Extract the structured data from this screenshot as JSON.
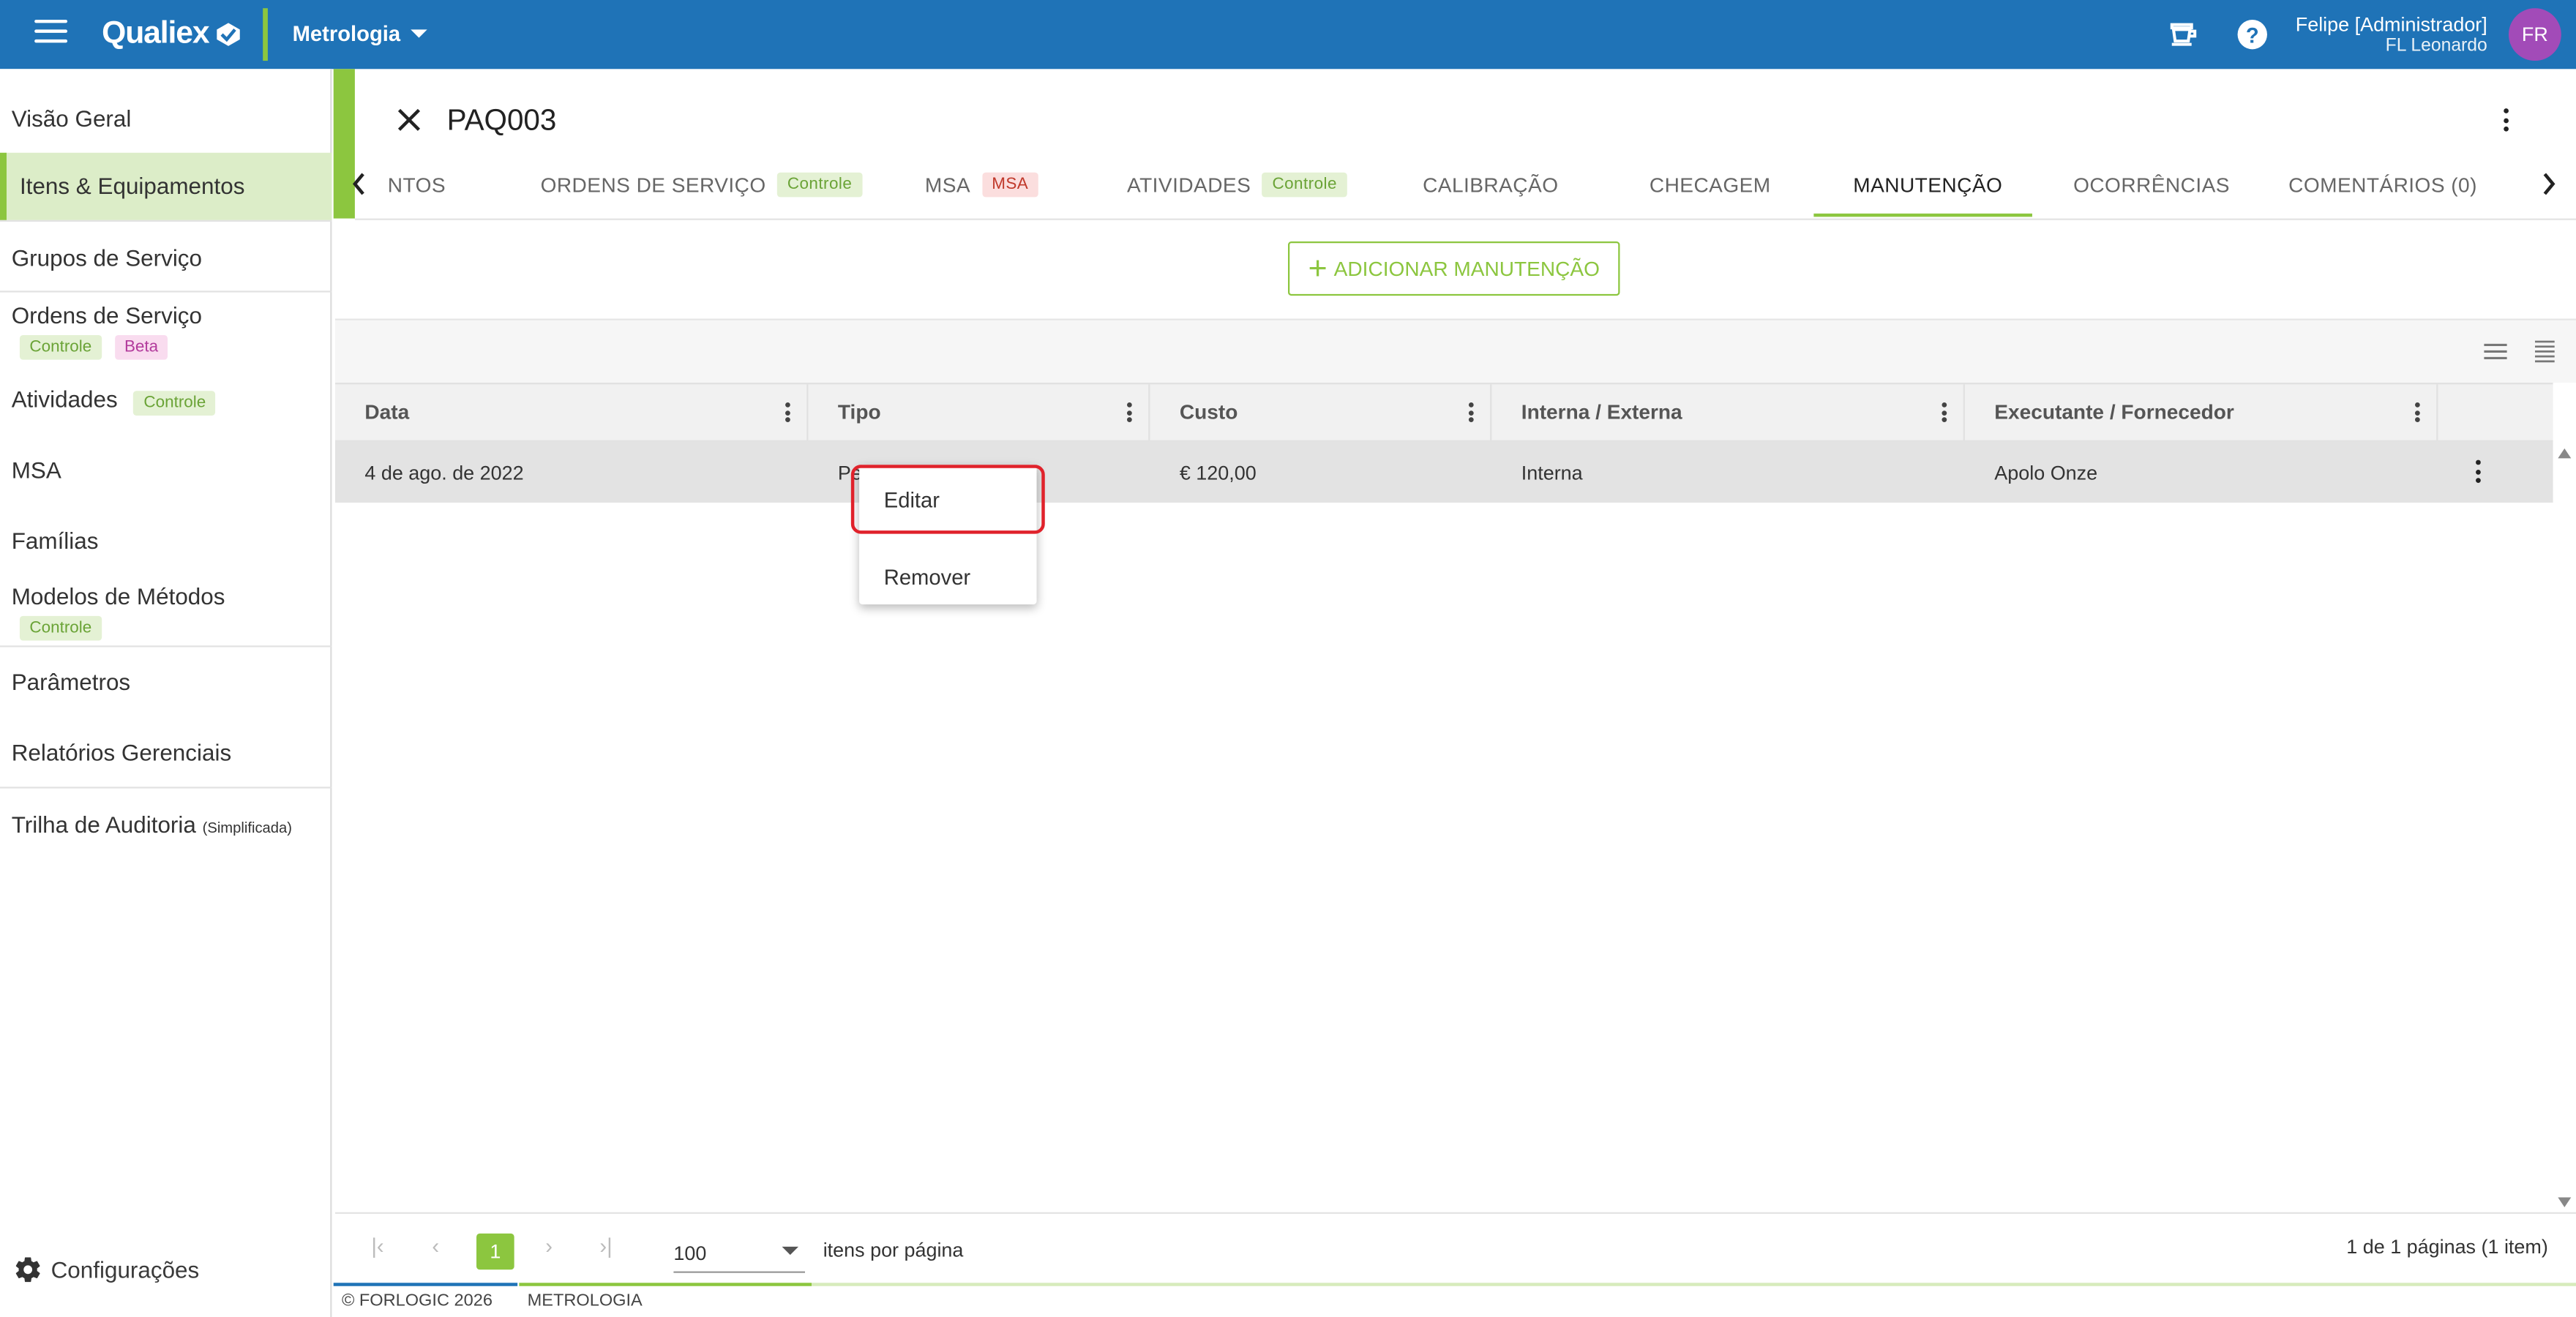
{
  "topbar": {
    "brand": "Qualiex",
    "module": "Metrologia",
    "user_name": "Felipe [Administrador]",
    "user_sub": "FL Leonardo",
    "avatar_initials": "FR",
    "color": "#1f73b7",
    "icons": [
      "menu-icon",
      "coffee-cup-icon",
      "help-icon"
    ]
  },
  "sidebar": {
    "items": [
      {
        "label": "Visão Geral"
      },
      {
        "label": "Itens & Equipamentos",
        "active": true
      },
      {
        "label": "Grupos de Serviço"
      },
      {
        "label": "Ordens de Serviço",
        "tags": [
          "Controle",
          "Beta"
        ]
      },
      {
        "label": "Atividades",
        "tags": [
          "Controle"
        ]
      },
      {
        "label": "MSA"
      },
      {
        "label": "Famílias"
      },
      {
        "label": "Modelos de Métodos",
        "tags": [
          "Controle"
        ]
      },
      {
        "label": "Parâmetros"
      },
      {
        "label": "Relatórios Gerenciais"
      },
      {
        "label": "Trilha de Auditoria",
        "suffix": "(Simplificada)"
      }
    ],
    "settings_label": "Configurações"
  },
  "detail": {
    "title": "PAQ003",
    "tabs": [
      {
        "label": "NTOS"
      },
      {
        "label": "ORDENS DE SERVIÇO",
        "tag": "Controle"
      },
      {
        "label": "MSA",
        "tag": "MSA"
      },
      {
        "label": "ATIVIDADES",
        "tag": "Controle"
      },
      {
        "label": "CALIBRAÇÃO"
      },
      {
        "label": "CHECAGEM"
      },
      {
        "label": "MANUTENÇÃO",
        "active": true
      },
      {
        "label": "OCORRÊNCIAS"
      },
      {
        "label": "COMENTÁRIOS (0)"
      }
    ],
    "add_button": "ADICIONAR MANUTENÇÃO"
  },
  "grid": {
    "columns": [
      "Data",
      "Tipo",
      "Custo",
      "Interna / Externa",
      "Executante / Fornecedor"
    ],
    "rows": [
      {
        "data": "4 de ago. de 2022",
        "tipo": "Periódica",
        "custo": "€ 120,00",
        "interna": "Interna",
        "executante": "Apolo Onze"
      }
    ]
  },
  "context_menu": {
    "items": [
      "Editar",
      "Remover"
    ],
    "highlighted": "Editar"
  },
  "pager": {
    "current_page": "1",
    "page_size": "100",
    "page_size_label": "itens por página",
    "info": "1 de 1 páginas (1 item)"
  },
  "footer": {
    "copyright": "© FORLOGIC 2026",
    "module": "METROLOGIA"
  }
}
